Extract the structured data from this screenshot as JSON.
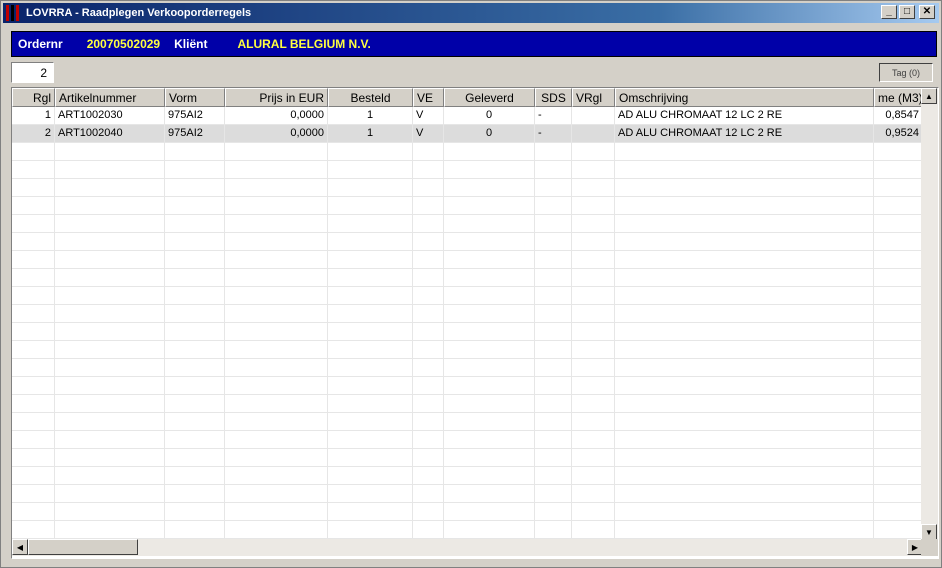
{
  "window": {
    "title": "LOVRRA - Raadplegen Verkooporderregels",
    "minimize_glyph": "_",
    "maximize_glyph": "□",
    "close_glyph": "✕"
  },
  "header": {
    "order_label": "Ordernr",
    "order_value": "20070502029",
    "client_label": "Kliënt",
    "client_value": "ALURAL BELGIUM N.V."
  },
  "toolbar": {
    "row_count": "2",
    "tag_button": "Tag (0)"
  },
  "table": {
    "columns": [
      "Rgl",
      "Artikelnummer",
      "Vorm",
      "Prijs in EUR",
      "Besteld",
      "VE",
      "Geleverd",
      "SDS",
      "VRgl",
      "Omschrijving",
      "me (M3)"
    ],
    "rows": [
      [
        "1",
        "ART1002030",
        "975AI2",
        "0,0000",
        "1",
        "V",
        "0",
        "-",
        "",
        "AD ALU CHROMAAT 12 LC 2 RE",
        "0,8547"
      ],
      [
        "2",
        "ART1002040",
        "975AI2",
        "0,0000",
        "1",
        "V",
        "0",
        "-",
        "",
        "AD ALU CHROMAAT 12 LC 2 RE",
        "0,9524"
      ]
    ]
  },
  "scrollbars": {
    "up_glyph": "▲",
    "down_glyph": "▼",
    "left_glyph": "◀",
    "right_glyph": "▶"
  }
}
